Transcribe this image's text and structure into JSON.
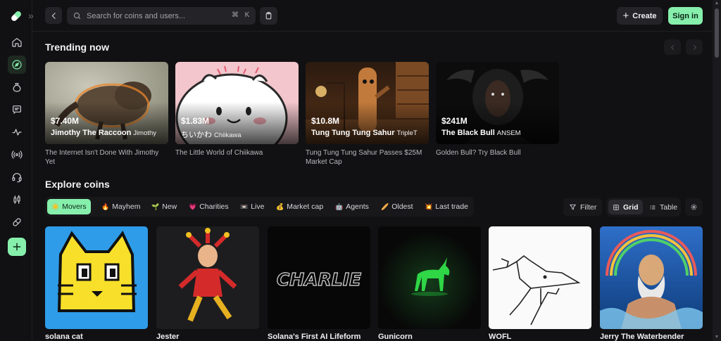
{
  "topbar": {
    "search_placeholder": "Search for coins and users...",
    "shortcut_mod": "⌘",
    "shortcut_key": "K",
    "create_label": "Create",
    "signin_label": "Sign in"
  },
  "sidebar": {
    "expand_glyph": "»"
  },
  "trending": {
    "title": "Trending now",
    "cards": [
      {
        "mcap": "$7.40M",
        "name": "Jimothy The Raccoon",
        "ticker": "Jimothy",
        "desc": "The Internet Isn't Done With Jimothy Yet"
      },
      {
        "mcap": "$1.83M",
        "name": "ちいかわ",
        "ticker": "Chiikawa",
        "desc": "The Little World of Chiikawa"
      },
      {
        "mcap": "$10.8M",
        "name": "Tung Tung Tung Sahur",
        "ticker": "TripleT",
        "desc": "Tung Tung Tung Sahur Passes $25M Market Cap"
      },
      {
        "mcap": "$241M",
        "name": "The Black Bull",
        "ticker": "ANSEM",
        "desc": "Golden Bull? Try Black Bull"
      }
    ]
  },
  "explore": {
    "title": "Explore coins",
    "filters": [
      {
        "emoji": "☀️",
        "label": "Movers"
      },
      {
        "emoji": "🔥",
        "label": "Mayhem"
      },
      {
        "emoji": "🌱",
        "label": "New"
      },
      {
        "emoji": "💗",
        "label": "Charities"
      },
      {
        "emoji": "📼",
        "label": "Live"
      },
      {
        "emoji": "💰",
        "label": "Market cap"
      },
      {
        "emoji": "🤖",
        "label": "Agents"
      },
      {
        "emoji": "🥖",
        "label": "Oldest"
      },
      {
        "emoji": "💥",
        "label": "Last trade"
      }
    ],
    "filter_label": "Filter",
    "grid_label": "Grid",
    "table_label": "Table",
    "coins": [
      {
        "name": "solana cat"
      },
      {
        "name": "Jester"
      },
      {
        "name": "Solana's First AI Lifeform",
        "art_text": "CHARLIE"
      },
      {
        "name": "Gunicorn"
      },
      {
        "name": "WOFL"
      },
      {
        "name": "Jerry The Waterbender"
      }
    ]
  },
  "colors": {
    "accent": "#86efac",
    "background": "#111113",
    "surface": "#242428"
  }
}
